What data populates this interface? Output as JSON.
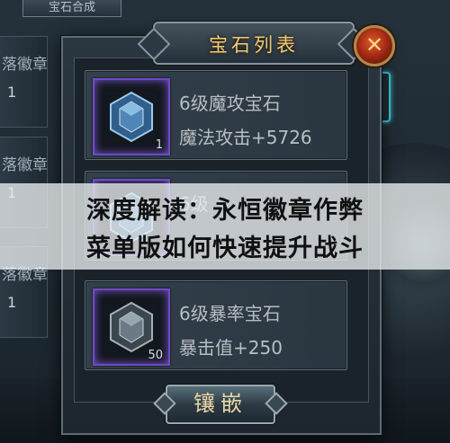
{
  "background": {
    "tab_label": "宝石合成",
    "rows": [
      {
        "title": "落徽章",
        "count": "1"
      },
      {
        "title": "落徽章",
        "count": "1"
      },
      {
        "title": "落徽章",
        "count": "1"
      }
    ]
  },
  "window": {
    "title": "宝石列表",
    "close_label": "✕",
    "gems": [
      {
        "name": "6级魔攻宝石",
        "stat": "魔法攻击+5726",
        "quantity": "1",
        "color": "#4f86b8"
      },
      {
        "name": "6级",
        "stat": "",
        "quantity": "",
        "color": "#4f86b8"
      },
      {
        "name": "6级暴率宝石",
        "stat": "暴击值+250",
        "quantity": "50",
        "color": "#6b7a86"
      }
    ],
    "embed_label": "镶嵌"
  },
  "overlay": {
    "line1": "深度解读：永恒徽章作弊",
    "line2": "菜单版如何快速提升战斗"
  },
  "colors": {
    "title_gold": "#e9c97a",
    "slot_purple": "#6e4cc2",
    "highlight_cyan": "#3fd0d8"
  }
}
